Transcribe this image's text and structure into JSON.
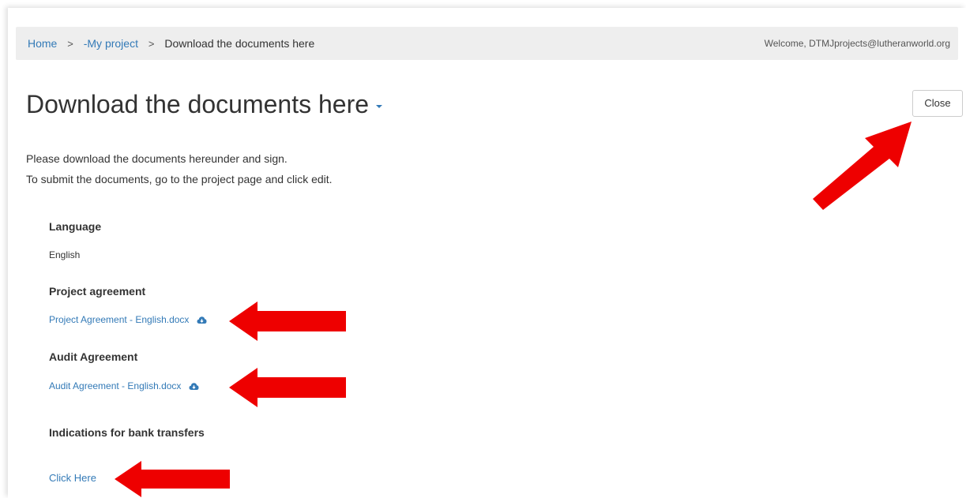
{
  "breadcrumb": {
    "home": "Home",
    "project": "-My project",
    "current": "Download the documents here",
    "separator": ">"
  },
  "welcome": "Welcome, DTMJprojects@lutheranworld.org",
  "page": {
    "title": "Download the documents here",
    "close_label": "Close",
    "intro_line1": "Please download the documents hereunder and sign.",
    "intro_line2": "To submit the documents, go to the project page and click edit."
  },
  "fields": {
    "language_label": "Language",
    "language_value": "English",
    "project_agreement_label": "Project agreement",
    "project_agreement_file": "Project Agreement - English.docx",
    "audit_agreement_label": "Audit Agreement",
    "audit_agreement_file": "Audit Agreement - English.docx",
    "bank_label": "Indications for bank transfers",
    "bank_link": "Click Here"
  },
  "icons": {
    "download": "cloud-download-icon",
    "caret": "caret-down-icon",
    "annotation": "red-arrow-icon"
  },
  "colors": {
    "link": "#337ab7",
    "breadcrumb_bg": "#eeeeee",
    "annotation_arrow": "#ee0000"
  }
}
